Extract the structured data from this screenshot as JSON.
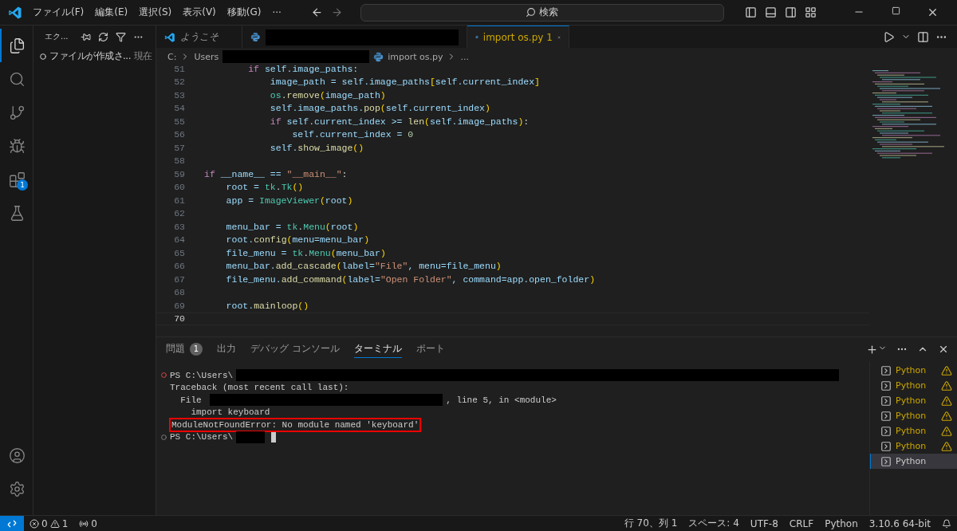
{
  "title_bar": {
    "menu": [
      "ファイル(F)",
      "編集(E)",
      "選択(S)",
      "表示(V)",
      "移動(G)",
      "···"
    ],
    "search": {
      "placeholder": "検索"
    }
  },
  "activity_bar": [
    {
      "kind": "explorer",
      "selected": true
    },
    {
      "kind": "search",
      "selected": false
    },
    {
      "kind": "source-control",
      "selected": false
    },
    {
      "kind": "run",
      "selected": false
    },
    {
      "kind": "extensions",
      "selected": false,
      "badge": "1"
    },
    {
      "kind": "testing",
      "selected": false
    }
  ],
  "sidebar": {
    "title": "エク...",
    "items": [
      {
        "label": "ファイルが作成さ...",
        "meta": "現在"
      }
    ]
  },
  "tabs": [
    {
      "kind": "welcome",
      "label": "ようこそ",
      "selected": false
    },
    {
      "kind": "python",
      "redacted": true,
      "selected": false
    },
    {
      "kind": "python",
      "label": "import os.py",
      "problems": "1",
      "selected": true
    }
  ],
  "breadcrumb": {
    "drive": "C:",
    "folder": "Users",
    "file": "import os.py",
    "more": "..."
  },
  "code_lines": [
    {
      "number": "51",
      "tokens": [
        {
          "text": "        if",
          "kind": "keyword"
        },
        {
          "text": " self.image_paths:",
          "kind": "variable"
        }
      ]
    },
    {
      "number": "52",
      "tokens": [
        {
          "text": "            image_path = self.image_paths",
          "kind": "variable"
        },
        {
          "text": "[",
          "kind": "bracket"
        },
        {
          "text": "self.current_index",
          "kind": "variable"
        },
        {
          "text": "]",
          "kind": "bracket"
        }
      ]
    },
    {
      "number": "53",
      "tokens": [
        {
          "text": "            os",
          "kind": "class"
        },
        {
          "text": ".remove",
          "kind": "function"
        },
        {
          "text": "(",
          "kind": "bracket"
        },
        {
          "text": "image_path",
          "kind": "variable"
        },
        {
          "text": ")",
          "kind": "bracket"
        }
      ]
    },
    {
      "number": "54",
      "tokens": [
        {
          "text": "            self.image_paths.",
          "kind": "variable"
        },
        {
          "text": "pop",
          "kind": "function"
        },
        {
          "text": "(",
          "kind": "bracket"
        },
        {
          "text": "self.current_index",
          "kind": "variable"
        },
        {
          "text": ")",
          "kind": "bracket"
        }
      ]
    },
    {
      "number": "55",
      "tokens": [
        {
          "text": "            if",
          "kind": "keyword"
        },
        {
          "text": " self.current_index >= ",
          "kind": "variable"
        },
        {
          "text": "len",
          "kind": "function"
        },
        {
          "text": "(",
          "kind": "bracket"
        },
        {
          "text": "self.image_paths",
          "kind": "variable"
        },
        {
          "text": ")",
          "kind": "bracket"
        },
        {
          "text": ":",
          "kind": "operator"
        }
      ]
    },
    {
      "number": "56",
      "tokens": [
        {
          "text": "                self.current_index = ",
          "kind": "variable"
        },
        {
          "text": "0",
          "kind": "number"
        }
      ]
    },
    {
      "number": "57",
      "tokens": [
        {
          "text": "            self.",
          "kind": "variable"
        },
        {
          "text": "show_image",
          "kind": "function"
        },
        {
          "text": "()",
          "kind": "bracket"
        }
      ]
    },
    {
      "number": "58"
    },
    {
      "number": "59",
      "tokens": [
        {
          "text": "if",
          "kind": "keyword"
        },
        {
          "text": " __name__ == ",
          "kind": "variable"
        },
        {
          "text": "\"__main__\"",
          "kind": "string"
        },
        {
          "text": ":",
          "kind": "operator"
        }
      ]
    },
    {
      "number": "60",
      "tokens": [
        {
          "text": "    root = ",
          "kind": "variable"
        },
        {
          "text": "tk",
          "kind": "class"
        },
        {
          "text": ".",
          "kind": "operator"
        },
        {
          "text": "Tk",
          "kind": "class"
        },
        {
          "text": "()",
          "kind": "bracket"
        }
      ]
    },
    {
      "number": "61",
      "tokens": [
        {
          "text": "    app = ",
          "kind": "variable"
        },
        {
          "text": "ImageViewer",
          "kind": "class"
        },
        {
          "text": "(",
          "kind": "bracket"
        },
        {
          "text": "root",
          "kind": "variable"
        },
        {
          "text": ")",
          "kind": "bracket"
        }
      ]
    },
    {
      "number": "62"
    },
    {
      "number": "63",
      "tokens": [
        {
          "text": "    menu_bar = ",
          "kind": "variable"
        },
        {
          "text": "tk",
          "kind": "class"
        },
        {
          "text": ".",
          "kind": "operator"
        },
        {
          "text": "Menu",
          "kind": "class"
        },
        {
          "text": "(",
          "kind": "bracket"
        },
        {
          "text": "root",
          "kind": "variable"
        },
        {
          "text": ")",
          "kind": "bracket"
        }
      ]
    },
    {
      "number": "64",
      "tokens": [
        {
          "text": "    root.",
          "kind": "variable"
        },
        {
          "text": "config",
          "kind": "function"
        },
        {
          "text": "(",
          "kind": "bracket"
        },
        {
          "text": "menu=menu_bar",
          "kind": "variable"
        },
        {
          "text": ")",
          "kind": "bracket"
        }
      ]
    },
    {
      "number": "65",
      "tokens": [
        {
          "text": "    file_menu = ",
          "kind": "variable"
        },
        {
          "text": "tk",
          "kind": "class"
        },
        {
          "text": ".",
          "kind": "operator"
        },
        {
          "text": "Menu",
          "kind": "class"
        },
        {
          "text": "(",
          "kind": "bracket"
        },
        {
          "text": "menu_bar",
          "kind": "variable"
        },
        {
          "text": ")",
          "kind": "bracket"
        }
      ]
    },
    {
      "number": "66",
      "tokens": [
        {
          "text": "    menu_bar.",
          "kind": "variable"
        },
        {
          "text": "add_cascade",
          "kind": "function"
        },
        {
          "text": "(",
          "kind": "bracket"
        },
        {
          "text": "label=",
          "kind": "variable"
        },
        {
          "text": "\"File\"",
          "kind": "string"
        },
        {
          "text": ", menu=file_menu",
          "kind": "variable"
        },
        {
          "text": ")",
          "kind": "bracket"
        }
      ]
    },
    {
      "number": "67",
      "tokens": [
        {
          "text": "    file_menu.",
          "kind": "variable"
        },
        {
          "text": "add_command",
          "kind": "function"
        },
        {
          "text": "(",
          "kind": "bracket"
        },
        {
          "text": "label=",
          "kind": "variable"
        },
        {
          "text": "\"Open Folder\"",
          "kind": "string"
        },
        {
          "text": ", command=app.open_folder",
          "kind": "variable"
        },
        {
          "text": ")",
          "kind": "bracket"
        }
      ]
    },
    {
      "number": "68"
    },
    {
      "number": "69",
      "tokens": [
        {
          "text": "    root.",
          "kind": "variable"
        },
        {
          "text": "mainloop",
          "kind": "function"
        },
        {
          "text": "()",
          "kind": "bracket"
        }
      ]
    },
    {
      "number": "70",
      "current": true
    }
  ],
  "panel_tabs": [
    {
      "label": "問題",
      "badge": "1",
      "selected": false
    },
    {
      "label": "出力",
      "selected": false
    },
    {
      "label": "デバッグ コンソール",
      "selected": false
    },
    {
      "label": "ターミナル",
      "selected": true
    },
    {
      "label": "ポート",
      "selected": false
    }
  ],
  "terminal": [
    {
      "kind": "prompt",
      "error": true,
      "text": "PS C:\\Users\\",
      "redacted": true,
      "cursor": false
    },
    {
      "kind": "output",
      "text": "Traceback (most recent call last):"
    },
    {
      "kind": "file",
      "prefix": "  File ",
      "suffix": ", line 5, in <module>"
    },
    {
      "kind": "output",
      "text": "    import keyboard"
    },
    {
      "kind": "output",
      "text": "ModuleNotFoundError: No module named 'keyboard'",
      "highlighted": true
    },
    {
      "kind": "prompt",
      "error": false,
      "text": "PS C:\\Users\\",
      "redacted": true,
      "cursor": true
    }
  ],
  "terminals": [
    {
      "label": "Python",
      "warning": true,
      "selected": false
    },
    {
      "label": "Python",
      "warning": true,
      "selected": false
    },
    {
      "label": "Python",
      "warning": true,
      "selected": false
    },
    {
      "label": "Python",
      "warning": true,
      "selected": false
    },
    {
      "label": "Python",
      "warning": true,
      "selected": false
    },
    {
      "label": "Python",
      "warning": true,
      "selected": false
    },
    {
      "label": "Python",
      "warning": false,
      "selected": true
    }
  ],
  "status_bar": {
    "errors": "0",
    "warnings": "1",
    "ports": "0",
    "right": [
      "行 70、列 1",
      "スペース: 4",
      "UTF-8",
      "CRLF",
      "Python",
      "3.10.6 64-bit"
    ]
  }
}
